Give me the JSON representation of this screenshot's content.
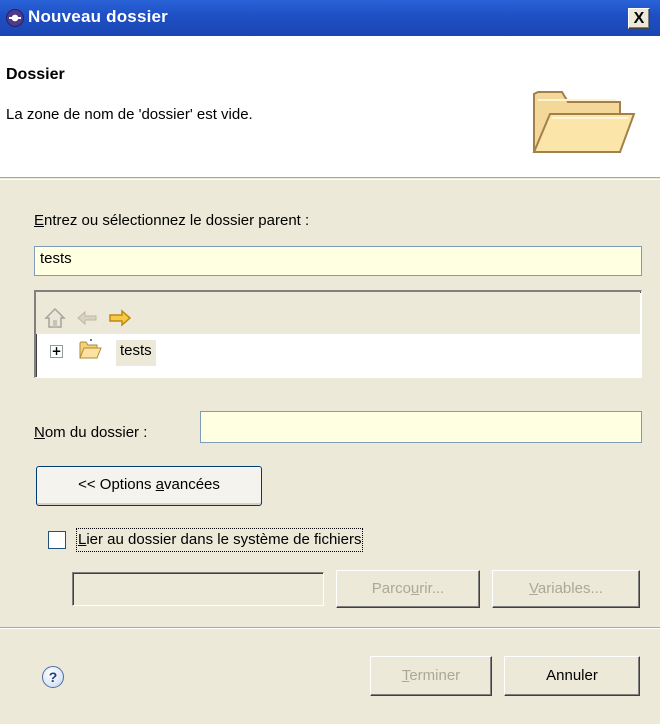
{
  "window": {
    "title": "Nouveau dossier",
    "close_label": "X"
  },
  "banner": {
    "title": "Dossier",
    "message": "La zone de nom de 'dossier' est vide."
  },
  "parent": {
    "label_mnemonic": "E",
    "label_rest": "ntrez ou sélectionnez le dossier parent :",
    "value": "tests"
  },
  "tree": {
    "expander": "+",
    "items": [
      {
        "label": "tests"
      }
    ]
  },
  "folder_name": {
    "label_mnemonic": "N",
    "label_rest": "om du dossier :",
    "value": ""
  },
  "advanced": {
    "label_pre": "<< Options ",
    "label_mnemonic": "a",
    "label_post": "vancées"
  },
  "link": {
    "checked": false,
    "label_mnemonic": "L",
    "label_rest": "ier au dossier dans le système de fichiers",
    "path_value": "",
    "browse_pre": "Parco",
    "browse_mnemonic": "u",
    "browse_post": "rir...",
    "variables_mnemonic": "V",
    "variables_rest": "ariables..."
  },
  "footer": {
    "help_icon": "?",
    "finish_mnemonic": "T",
    "finish_rest": "erminer",
    "cancel_label": "Annuler"
  },
  "colors": {
    "titlebar": "#1e4fc3",
    "dialog_bg": "#ece9d8",
    "field_bg": "#ffffe1"
  }
}
